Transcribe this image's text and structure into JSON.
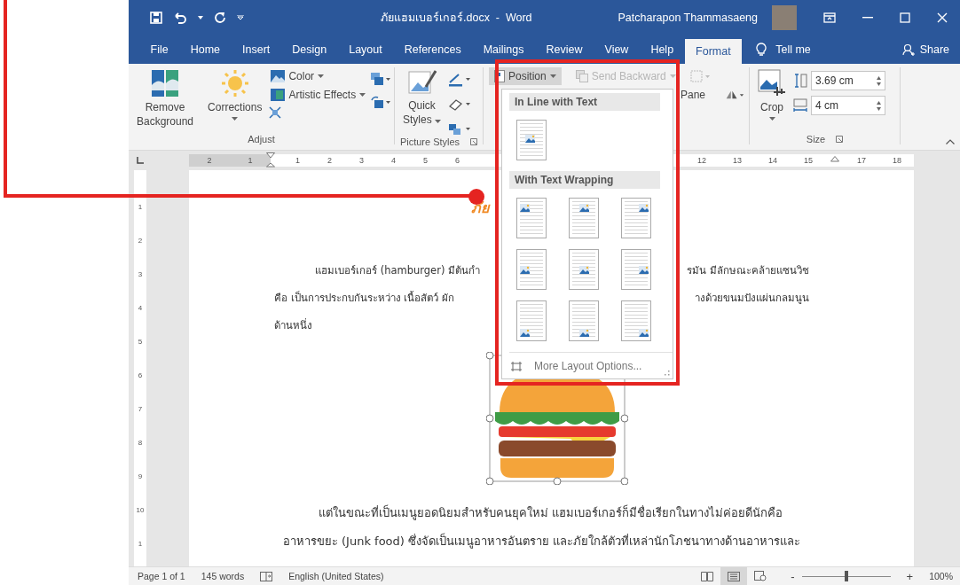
{
  "window": {
    "title": "ภัยแฮมเบอร์เกอร์.docx  -  Word",
    "user": "Patcharapon Thammasaeng"
  },
  "tabs": [
    {
      "label": "File",
      "selected": false
    },
    {
      "label": "Home",
      "selected": false
    },
    {
      "label": "Insert",
      "selected": false
    },
    {
      "label": "Design",
      "selected": false
    },
    {
      "label": "Layout",
      "selected": false
    },
    {
      "label": "References",
      "selected": false
    },
    {
      "label": "Mailings",
      "selected": false
    },
    {
      "label": "Review",
      "selected": false
    },
    {
      "label": "View",
      "selected": false
    },
    {
      "label": "Help",
      "selected": false
    },
    {
      "label": "Format",
      "selected": true
    }
  ],
  "tell_me": "Tell me",
  "share": "Share",
  "ribbon": {
    "adjust": {
      "label": "Adjust",
      "remove_background": [
        "Remove",
        "Background"
      ],
      "corrections": "Corrections",
      "recolor": "Color",
      "artistic_effects": "Artistic Effects"
    },
    "picture_styles": {
      "label": "Picture Styles",
      "quick_styles": [
        "Quick",
        "Styles"
      ]
    },
    "arrange": {
      "position": {
        "label": "Position",
        "expanded": true
      },
      "send_backward": "Send Backward",
      "pane": "Pane"
    },
    "size": {
      "label": "Size",
      "crop": "Crop",
      "height": "3.69 cm",
      "width": "4 cm"
    }
  },
  "ruler": {
    "left_numbers": [
      "2",
      "1"
    ],
    "numbers": [
      "1",
      "2",
      "3",
      "4",
      "5",
      "6"
    ],
    "right_numbers": [
      "12",
      "13",
      "14",
      "15",
      "17",
      "18"
    ],
    "vertical_numbers": [
      "1",
      "2",
      "3",
      "4",
      "5",
      "6",
      "7",
      "8",
      "9",
      "10",
      "1"
    ]
  },
  "document": {
    "title_fragment": "ภัย",
    "paragraph_1": [
      {
        "left": "แฮมเบอร์เกอร์ (hamburger) มีต้นกำ",
        "right": "รมัน มีลักษณะคล้ายแซนวิช"
      },
      {
        "left": "คือ เป็นการประกบกันระหว่าง เนื้อสัตว์ ผัก",
        "right": "างด้วยขนมปังแผ่นกลมนูน"
      },
      {
        "left": "ด้านหนึ่ง"
      }
    ],
    "paragraph_2": [
      "แต่ในขณะที่เป็นเมนูยอดนิยมสำหรับคนยุคใหม่  แฮมเบอร์เกอร์ก็มีชื่อเรียกในทางไม่ค่อยดีนักคือ",
      "อาหารขยะ (Junk food) ซึ่งจัดเป็นเมนูอาหารอันตราย และภัยใกล้ตัวที่เหล่านักโภชนาทางด้านอาหารและ"
    ]
  },
  "position_menu": {
    "sections": [
      {
        "title": "In Line with Text",
        "options": [
          {
            "kind": "inline"
          }
        ]
      },
      {
        "title": "With Text Wrapping",
        "options": [
          {
            "kind": "top-left"
          },
          {
            "kind": "top-center"
          },
          {
            "kind": "top-right"
          },
          {
            "kind": "middle-left"
          },
          {
            "kind": "middle-center"
          },
          {
            "kind": "middle-right"
          },
          {
            "kind": "bottom-left"
          },
          {
            "kind": "bottom-center"
          },
          {
            "kind": "bottom-right"
          }
        ]
      }
    ],
    "more": "More Layout Options..."
  },
  "status_bar": {
    "page": "Page 1 of 1",
    "words": "145 words",
    "language": "English (United States)",
    "views": [
      {
        "kind": "read",
        "selected": false
      },
      {
        "kind": "print",
        "selected": true
      },
      {
        "kind": "web",
        "selected": false
      }
    ],
    "zoom_minus": "-",
    "zoom_plus": "+",
    "zoom": {
      "level": 0.5
    },
    "zoom_label": "100%"
  }
}
